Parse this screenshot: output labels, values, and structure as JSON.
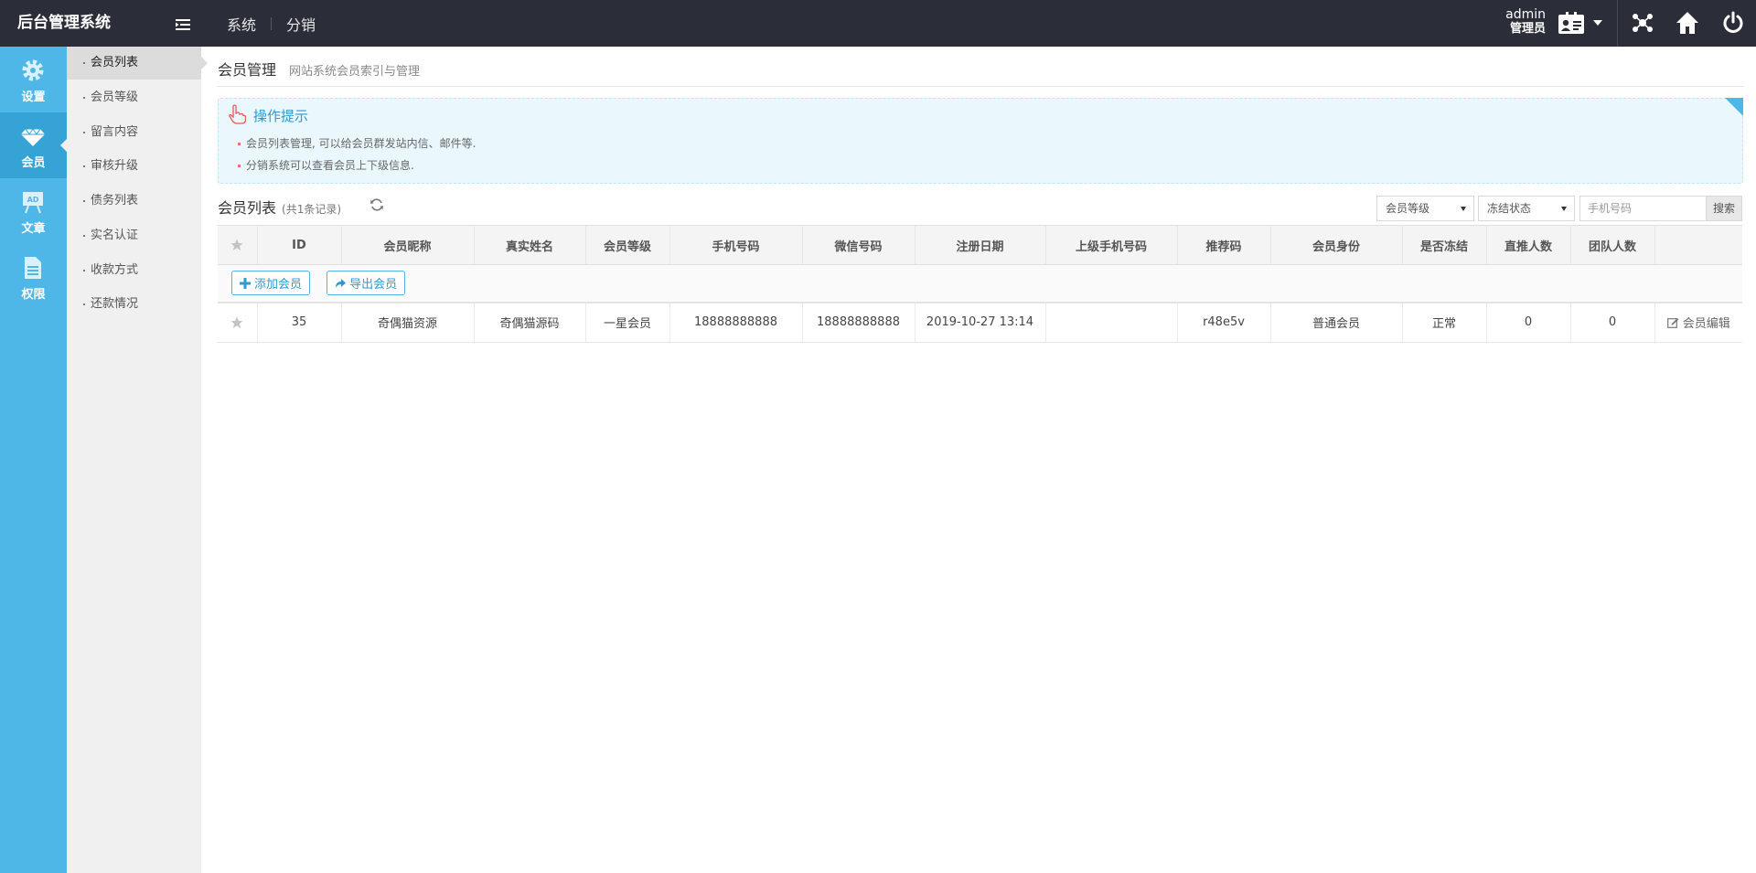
{
  "app": {
    "title": "后台管理系统"
  },
  "topnav": [
    "系统",
    "分销"
  ],
  "user": {
    "name": "admin",
    "role": "管理员"
  },
  "rail": [
    {
      "label": "设置",
      "icon": "gear-icon"
    },
    {
      "label": "会员",
      "icon": "diamond-icon"
    },
    {
      "label": "文章",
      "icon": "ad-board-icon"
    },
    {
      "label": "权限",
      "icon": "document-icon"
    }
  ],
  "subnav": [
    "会员列表",
    "会员等级",
    "留言内容",
    "审核升级",
    "债务列表",
    "实名认证",
    "收款方式",
    "还款情况"
  ],
  "page": {
    "title": "会员管理",
    "subtitle": "网站系统会员索引与管理"
  },
  "tips": {
    "title": "操作提示",
    "lines": [
      "会员列表管理, 可以给会员群发站内信、邮件等.",
      "分销系统可以查看会员上下级信息."
    ]
  },
  "list": {
    "title": "会员列表",
    "count": "(共1条记录)"
  },
  "filters": {
    "level": "会员等级",
    "frozen": "冻结状态",
    "phone_placeholder": "手机号码",
    "search_label": "搜索"
  },
  "table": {
    "headers": [
      "ID",
      "会员昵称",
      "真实姓名",
      "会员等级",
      "手机号码",
      "微信号码",
      "注册日期",
      "上级手机号码",
      "推荐码",
      "会员身份",
      "是否冻结",
      "直推人数",
      "团队人数",
      ""
    ],
    "rows": [
      [
        "35",
        "奇偶猫资源",
        "奇偶猫源码",
        "一星会员",
        "18888888888",
        "18888888888",
        "2019-10-27 13:14",
        "",
        "r48e5v",
        "普通会员",
        "正常",
        "0",
        "0"
      ]
    ],
    "add_button": "添加会员",
    "export_button": "导出会员",
    "edit_label": "会员编辑"
  },
  "colors": {
    "topbar": "#2b2e38",
    "rail": "#4fb7e8",
    "accent": "#2e9ad0"
  }
}
